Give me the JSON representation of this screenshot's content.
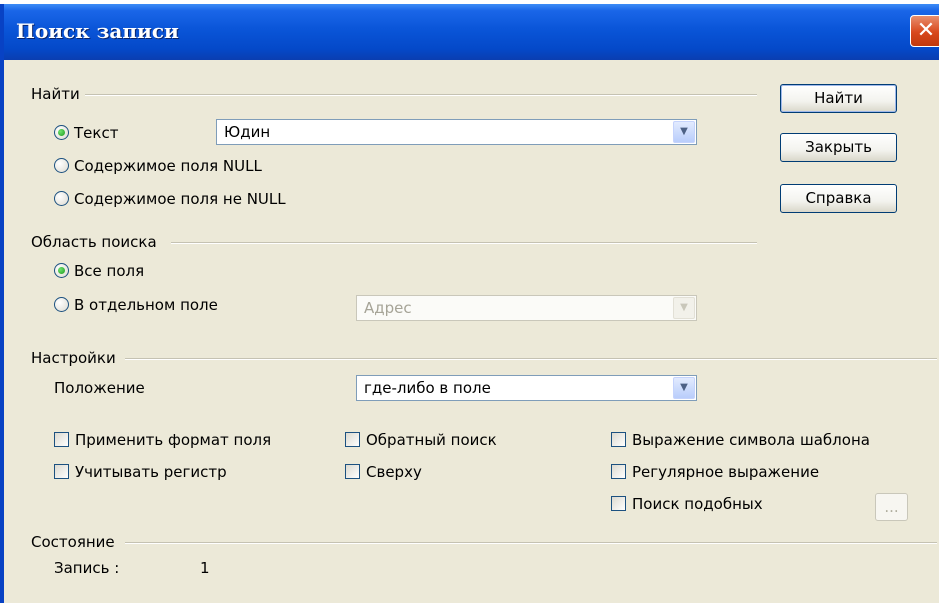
{
  "window": {
    "title": "Поиск записи",
    "close_glyph": "✕"
  },
  "find": {
    "section_label": "Найти",
    "options": [
      {
        "label": "Текст",
        "selected": true
      },
      {
        "label": "Содержимое поля NULL",
        "selected": false
      },
      {
        "label": "Содержимое поля не NULL",
        "selected": false
      }
    ],
    "text_value": "Юдин"
  },
  "scope": {
    "section_label": "Область поиска",
    "options": [
      {
        "label": "Все поля",
        "selected": true
      },
      {
        "label": "В отдельном поле",
        "selected": false
      }
    ],
    "field_value": "Адрес"
  },
  "settings": {
    "section_label": "Настройки",
    "position_label": "Положение",
    "position_value": "где-либо в поле",
    "checkboxes": [
      {
        "label": "Применить формат поля",
        "checked": false
      },
      {
        "label": "Учитывать регистр",
        "checked": false
      },
      {
        "label": "Обратный поиск",
        "checked": false
      },
      {
        "label": "Сверху",
        "checked": false
      },
      {
        "label": "Выражение символа шаблона",
        "checked": false
      },
      {
        "label": "Регулярное выражение",
        "checked": false
      },
      {
        "label": "Поиск подобных",
        "checked": false
      }
    ],
    "similarity_button": "..."
  },
  "status": {
    "section_label": "Состояние",
    "record_label": "Запись :",
    "record_value": "1"
  },
  "buttons": {
    "find": "Найти",
    "close": "Закрыть",
    "help": "Справка"
  },
  "icons": {
    "dropdown": "chevron-down-icon",
    "close": "close-icon"
  }
}
